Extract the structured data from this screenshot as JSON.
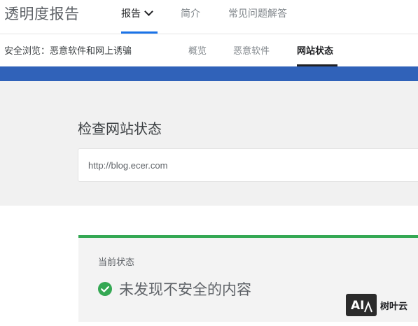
{
  "header": {
    "title": "透明度报告",
    "nav": [
      {
        "label": "报告"
      },
      {
        "label": "简介"
      },
      {
        "label": "常见问题解答"
      }
    ]
  },
  "subheader": {
    "section_title": "安全浏览：恶意软件和网上诱骗",
    "tabs": [
      {
        "label": "概览"
      },
      {
        "label": "恶意软件"
      },
      {
        "label": "网站状态"
      }
    ]
  },
  "search": {
    "heading": "检查网站状态",
    "value": "http://blog.ecer.com"
  },
  "result": {
    "label": "当前状态",
    "status_text": "未发现不安全的内容"
  },
  "watermark": {
    "text": "树叶云",
    "logo_text": "AI"
  },
  "colors": {
    "accent_blue": "#3062b9",
    "tab_indicator": "#1a73e8",
    "safe_green": "#34a853"
  },
  "icons": {
    "status": "check-circle-icon",
    "dropdown": "chevron-down-icon"
  }
}
